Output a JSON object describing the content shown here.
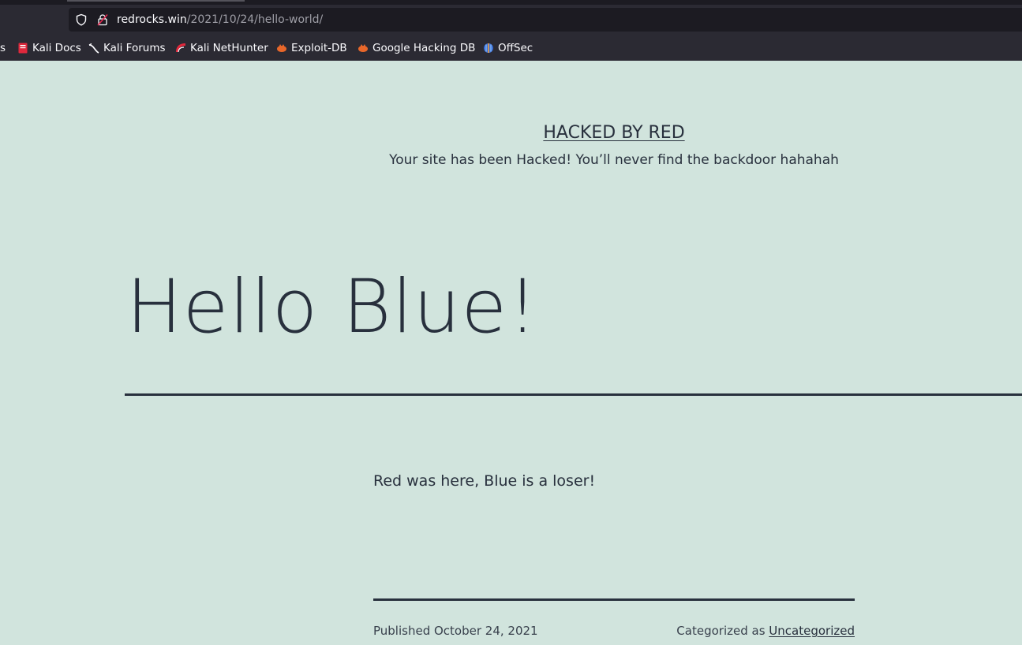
{
  "browser": {
    "url_domain": "redrocks.win",
    "url_path": "/2021/10/24/hello-world/",
    "bookmarks": [
      {
        "label": "s",
        "icon": "truncated-bookmark"
      },
      {
        "label": "Kali Docs",
        "icon": "kali-docs-icon"
      },
      {
        "label": "Kali Forums",
        "icon": "kali-dragon-icon"
      },
      {
        "label": "Kali NetHunter",
        "icon": "nethunter-icon"
      },
      {
        "label": "Exploit-DB",
        "icon": "exploit-db-icon"
      },
      {
        "label": "Google Hacking DB",
        "icon": "ghdb-icon"
      },
      {
        "label": "OffSec",
        "icon": "offsec-icon"
      }
    ]
  },
  "site": {
    "title": "HACKED BY RED",
    "description": "Your site has been Hacked! You’ll never find the backdoor hahahah"
  },
  "post": {
    "title": "Hello Blue!",
    "content": "Red was here, Blue is a loser!",
    "published_prefix": "Published",
    "published_date": "October 24, 2021",
    "categorized_prefix": "Categorized as",
    "category": "Uncategorized"
  },
  "colors": {
    "page_background": "#d1e4dd",
    "text": "#28303d",
    "chrome_background": "#2b2a33"
  }
}
